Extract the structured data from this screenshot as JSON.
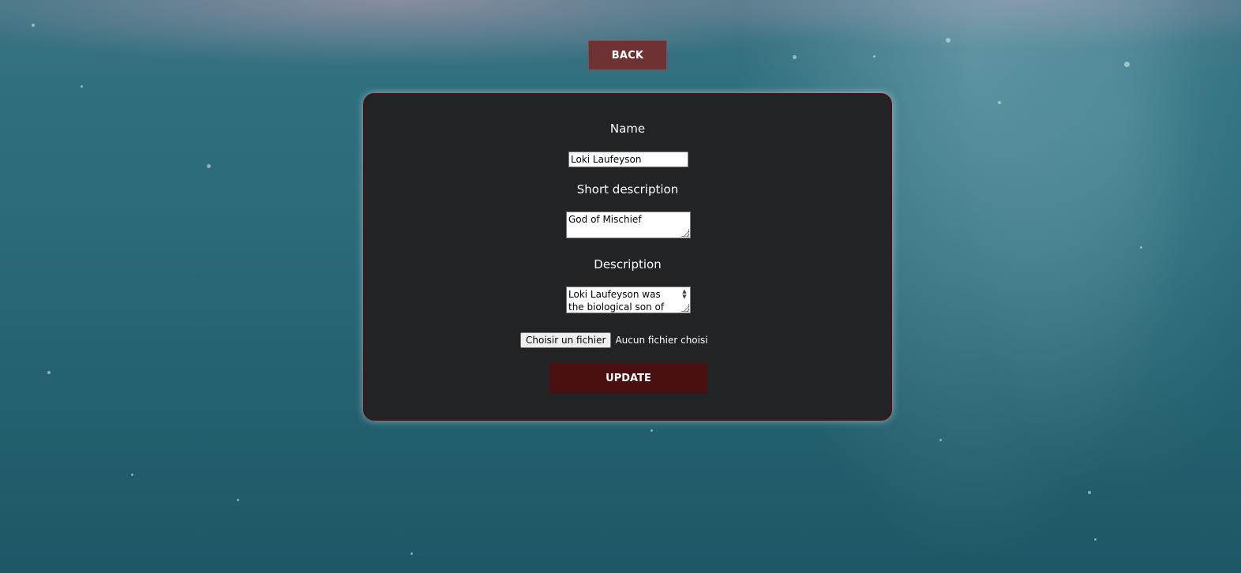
{
  "nav": {
    "back_label": "BACK"
  },
  "form": {
    "name_label": "Name",
    "name_value": "Loki Laufeyson",
    "short_description_label": "Short description",
    "short_description_value": "God of Mischief",
    "description_label": "Description",
    "description_value": "Loki Laufeyson was the biological son of Laufey,",
    "file_button_label": "Choisir un fichier",
    "file_status": "Aucun fichier choisi",
    "update_label": "UPDATE"
  },
  "colors": {
    "card_background": "#222324",
    "card_border": "#4a1012",
    "back_button": "#6e3234",
    "update_button": "#4a0f10",
    "water": "#2b6a79"
  }
}
